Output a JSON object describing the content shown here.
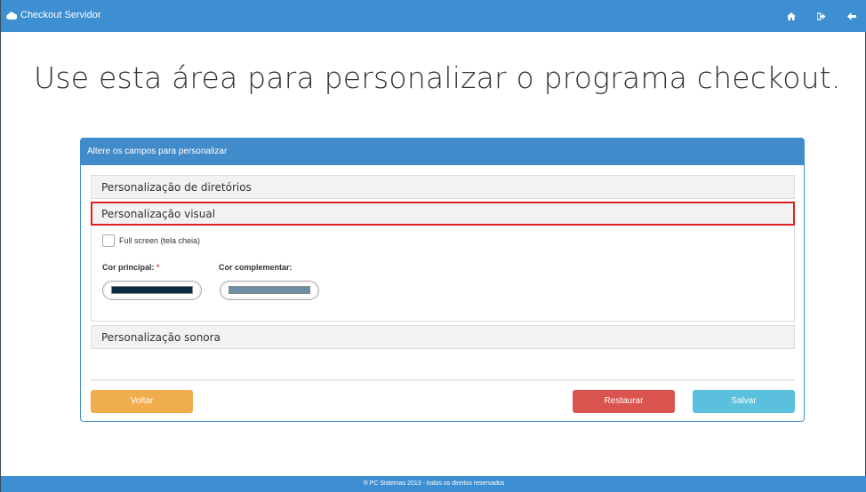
{
  "app": {
    "title": "Checkout Servidor",
    "icons": [
      "cloud-icon",
      "home-icon",
      "sign-out-icon",
      "back-arrow-icon"
    ]
  },
  "page": {
    "headline": "Use esta área para personalizar o programa checkout."
  },
  "panel": {
    "heading": "Altere os campos para personalizar",
    "accordion": [
      {
        "label": "Personalização de diretórios"
      },
      {
        "label": "Personalização visual"
      },
      {
        "label": "Personalização sonora"
      }
    ],
    "visual": {
      "fullscreen_label": "Full screen (tela cheia)",
      "fullscreen_checked": false,
      "primary_label": "Cor principal:",
      "primary_required": "*",
      "primary_color": "#0b2a3d",
      "secondary_label": "Cor complementar:",
      "secondary_color": "#6e8fa3"
    },
    "buttons": {
      "back": "Voltar",
      "restore": "Restaurar",
      "save": "Salvar"
    }
  },
  "footer": {
    "text": "® PC Sistemas 2013 - todos os direitos reservados"
  },
  "colors": {
    "brand_blue": "#3d8fd1",
    "back_button": "#f0ad4e",
    "restore_button": "#d9534f",
    "save_button": "#5bc0de",
    "highlight_border": "#e02020"
  }
}
